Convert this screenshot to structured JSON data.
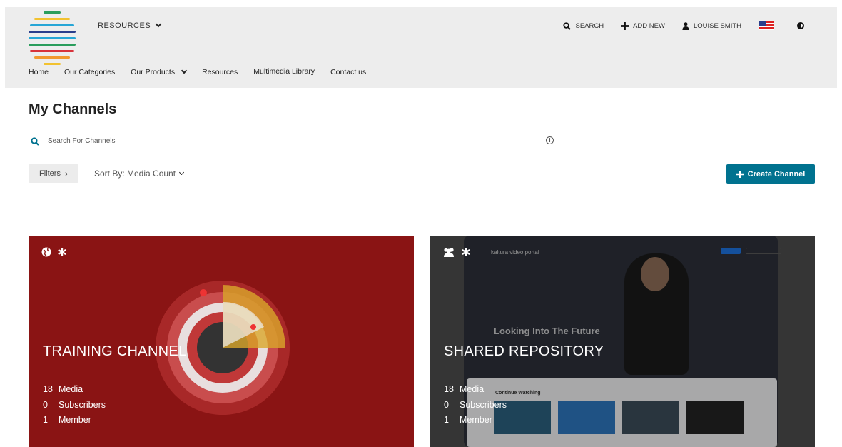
{
  "header": {
    "resources_label": "RESOURCES",
    "actions": {
      "search": "SEARCH",
      "add_new": "ADD NEW",
      "user": "LOUISE SMITH"
    },
    "logo_colors": [
      "#2a9d5c",
      "#f2c230",
      "#27a6d6",
      "#2a3e8c",
      "#27a6d6",
      "#2a9d5c",
      "#d8333c",
      "#f29a30",
      "#f2c230"
    ],
    "nav": [
      {
        "label": "Home"
      },
      {
        "label": "Our Categories"
      },
      {
        "label": "Our Products"
      },
      {
        "label": "Resources"
      },
      {
        "label": "Multimedia Library"
      },
      {
        "label": "Contact us"
      }
    ]
  },
  "page": {
    "title": "My Channels",
    "search_placeholder": "Search For Channels",
    "filters_label": "Filters",
    "sort_label": "Sort By: Media Count",
    "create_label": "Create Channel"
  },
  "channels": [
    {
      "title": "TRAINING CHANNEL",
      "stats": [
        {
          "count": "18",
          "label": "Media"
        },
        {
          "count": "0",
          "label": "Subscribers"
        },
        {
          "count": "1",
          "label": "Member"
        }
      ],
      "background": "#8a1414"
    },
    {
      "title": "SHARED REPOSITORY",
      "stats": [
        {
          "count": "18",
          "label": "Media"
        },
        {
          "count": "0",
          "label": "Subscribers"
        },
        {
          "count": "1",
          "label": "Member"
        }
      ],
      "screen_text": {
        "brand": "kaltura video portal",
        "headline": "Looking Into The Future",
        "strip_title": "Continue Watching"
      },
      "background": "#4a4a4a"
    }
  ],
  "colors": {
    "accent": "#00728f",
    "header_bg": "#ededed"
  }
}
